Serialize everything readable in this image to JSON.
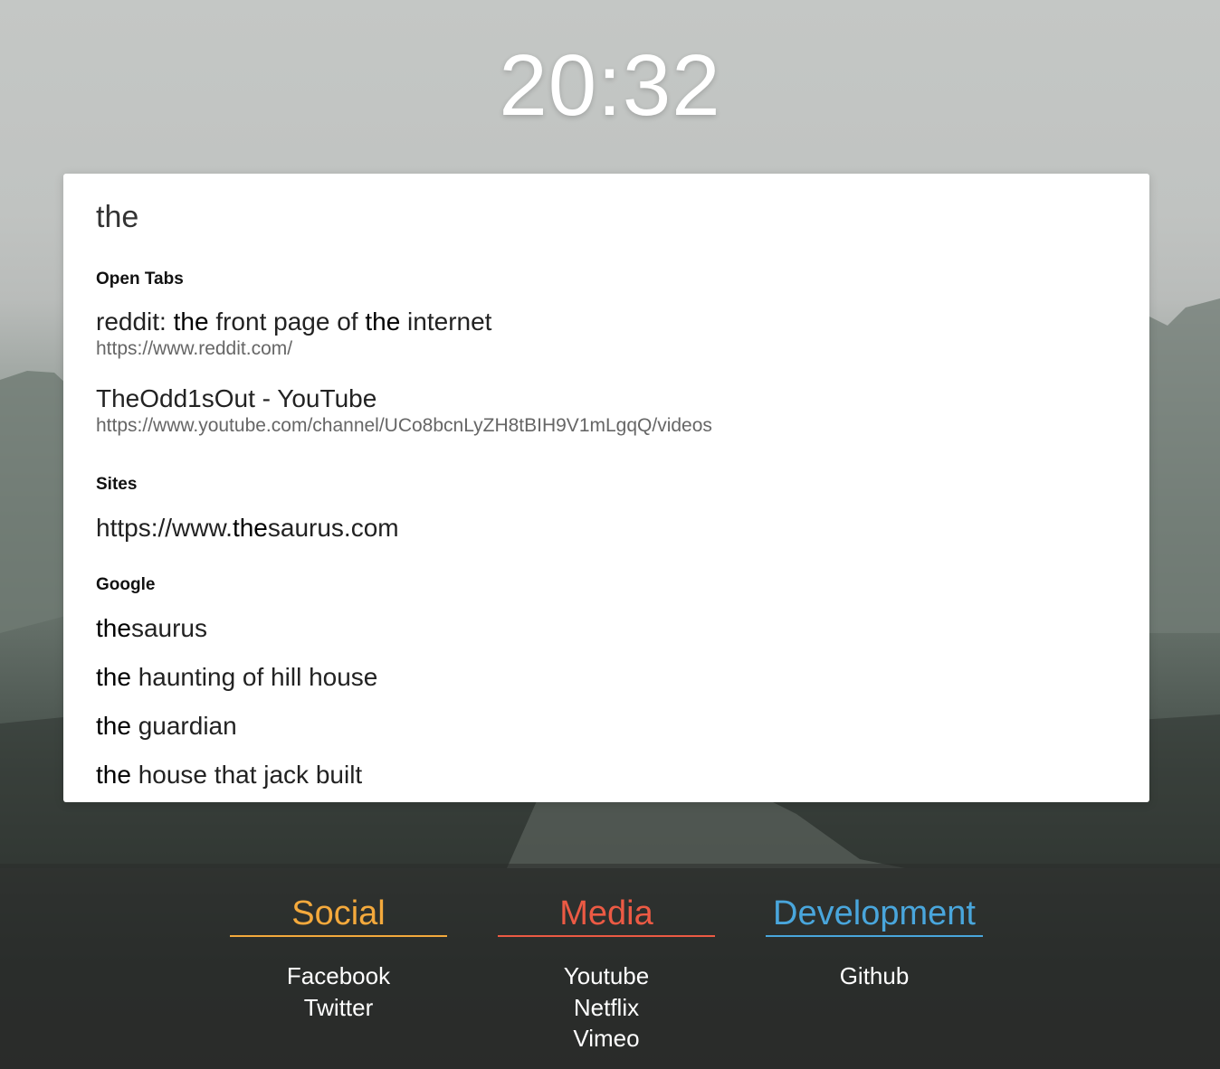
{
  "clock": "20:32",
  "search": {
    "value": "the"
  },
  "sections": {
    "open_tabs": {
      "heading": "Open Tabs",
      "items": [
        {
          "title_parts": [
            "reddit: ",
            "the",
            " front page of ",
            "the",
            " internet"
          ],
          "url": "https://www.reddit.com/"
        },
        {
          "title_parts": [
            "TheOdd1sOut - YouTube"
          ],
          "url": "https://www.youtube.com/channel/UCo8bcnLyZH8tBIH9V1mLgqQ/videos"
        }
      ]
    },
    "sites": {
      "heading": "Sites",
      "items": [
        {
          "title_parts": [
            "https://www.",
            "the",
            "saurus.com"
          ]
        }
      ]
    },
    "google": {
      "heading": "Google",
      "items": [
        {
          "title_parts": [
            "the",
            "saurus"
          ]
        },
        {
          "title_parts": [
            "the",
            " haunting of hill house"
          ]
        },
        {
          "title_parts": [
            "the",
            " guardian"
          ]
        },
        {
          "title_parts": [
            "the",
            " house that jack built"
          ]
        }
      ]
    }
  },
  "link_groups": {
    "social": {
      "title": "Social",
      "color": "#f4a93c",
      "links": [
        "Facebook",
        "Twitter"
      ]
    },
    "media": {
      "title": "Media",
      "color": "#ec5a44",
      "links": [
        "Youtube",
        "Netflix",
        "Vimeo"
      ]
    },
    "development": {
      "title": "Development",
      "color": "#49a6dc",
      "links": [
        "Github"
      ]
    }
  }
}
